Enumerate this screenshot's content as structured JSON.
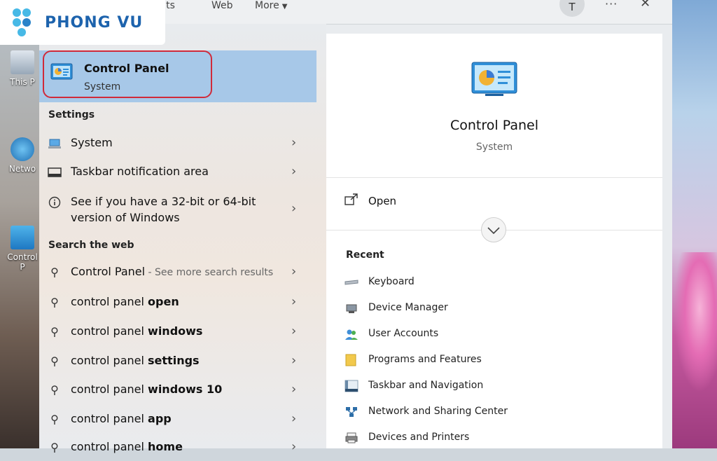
{
  "logo": {
    "text": "PHONG VU"
  },
  "desktop": {
    "icons": [
      {
        "label": "This P"
      },
      {
        "label": "Netwo"
      },
      {
        "label": "Control P"
      }
    ]
  },
  "topbar": {
    "tabs": [
      {
        "label": "ments"
      },
      {
        "label": "Web"
      },
      {
        "label": "More"
      }
    ],
    "avatar_initial": "T",
    "more_options": "···",
    "close": "✕"
  },
  "best_match": {
    "title": "Control Panel",
    "subtitle": "System"
  },
  "settings": {
    "heading": "Settings",
    "items": [
      {
        "label": "System",
        "icon": "laptop-icon"
      },
      {
        "label": "Taskbar notification area",
        "icon": "taskbar-icon"
      },
      {
        "label": "See if you have a 32-bit or 64-bit version of Windows",
        "icon": "info-icon"
      }
    ]
  },
  "web": {
    "heading": "Search the web",
    "items": [
      {
        "prefix": "Control Panel",
        "suffix": "",
        "hint": " - See more search results"
      },
      {
        "prefix": "control panel ",
        "suffix": "open",
        "hint": ""
      },
      {
        "prefix": "control panel ",
        "suffix": "windows",
        "hint": ""
      },
      {
        "prefix": "control panel ",
        "suffix": "settings",
        "hint": ""
      },
      {
        "prefix": "control panel ",
        "suffix": "windows 10",
        "hint": ""
      },
      {
        "prefix": "control panel ",
        "suffix": "app",
        "hint": ""
      },
      {
        "prefix": "control panel ",
        "suffix": "home",
        "hint": ""
      }
    ]
  },
  "detail": {
    "title": "Control Panel",
    "subtitle": "System",
    "open_label": "Open",
    "recent_heading": "Recent",
    "recent": [
      {
        "label": "Keyboard",
        "icon": "keyboard-icon"
      },
      {
        "label": "Device Manager",
        "icon": "device-manager-icon"
      },
      {
        "label": "User Accounts",
        "icon": "user-accounts-icon"
      },
      {
        "label": "Programs and Features",
        "icon": "folder-icon"
      },
      {
        "label": "Taskbar and Navigation",
        "icon": "taskbar-navigation-icon"
      },
      {
        "label": "Network and Sharing Center",
        "icon": "network-icon"
      },
      {
        "label": "Devices and Printers",
        "icon": "printer-icon"
      }
    ]
  },
  "colors": {
    "highlight": "#a7c8e8",
    "annotation_border": "#d02a3a",
    "logo_blue": "#1d63ad",
    "logo_light": "#47b9e6"
  }
}
